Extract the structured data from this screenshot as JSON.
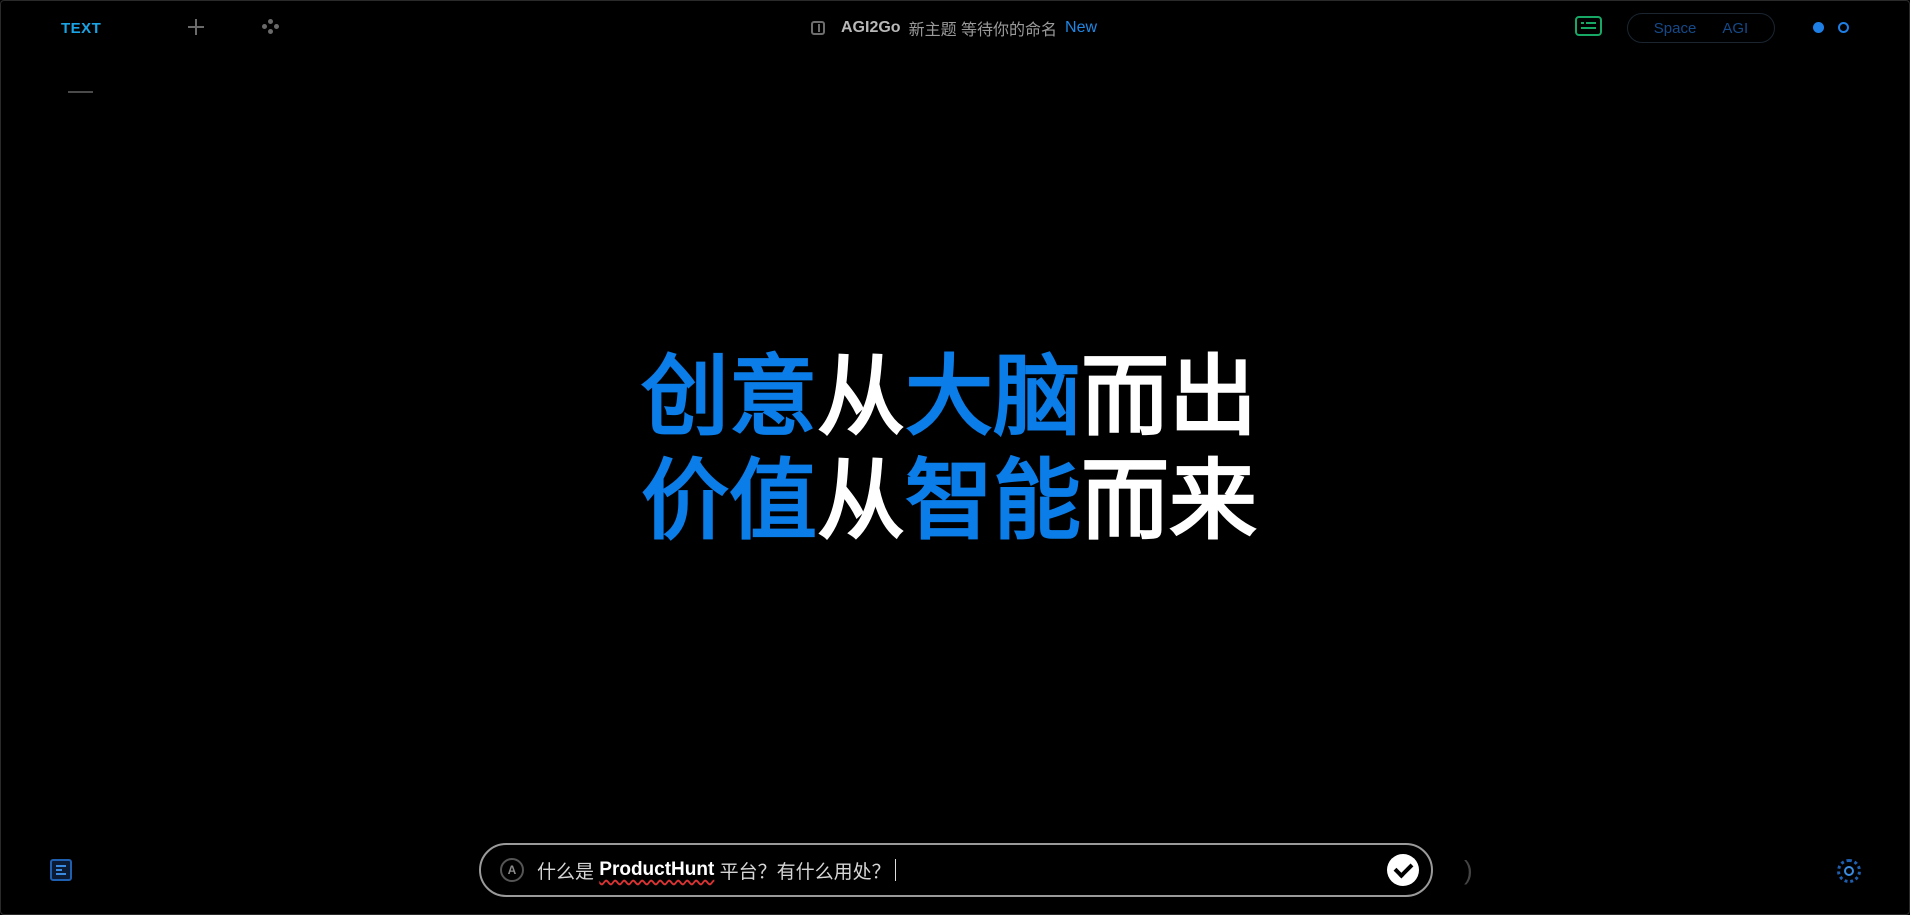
{
  "header": {
    "tab_label": "TEXT",
    "app_name": "AGI2Go",
    "topic_title": "新主题 等待你的命名",
    "new_badge": "New",
    "space_toggle": {
      "left": "Space",
      "right": "AGI"
    }
  },
  "hero": {
    "line1": [
      {
        "text": "创意",
        "color": "blue"
      },
      {
        "text": "从",
        "color": "white"
      },
      {
        "text": "大脑",
        "color": "blue"
      },
      {
        "text": "而出",
        "color": "white"
      }
    ],
    "line2": [
      {
        "text": "价值",
        "color": "blue"
      },
      {
        "text": "从",
        "color": "white"
      },
      {
        "text": "智能",
        "color": "blue"
      },
      {
        "text": "而来",
        "color": "white"
      }
    ]
  },
  "input": {
    "value_prefix": "什么是 ",
    "value_highlight": "ProductHunt",
    "value_suffix": " 平台？有什么用处？",
    "mode_icon_letter": "A"
  },
  "side_glyph": ")",
  "icons": [
    "plus-icon",
    "gamepad-icon",
    "panel-icon",
    "keyboard-icon",
    "document-icon",
    "settings-gear-icon",
    "submit-check-icon"
  ],
  "colors": {
    "accent_blue": "#0b7de8",
    "tab_cyan": "#1aa4e6",
    "keyboard_green": "#17a865"
  }
}
